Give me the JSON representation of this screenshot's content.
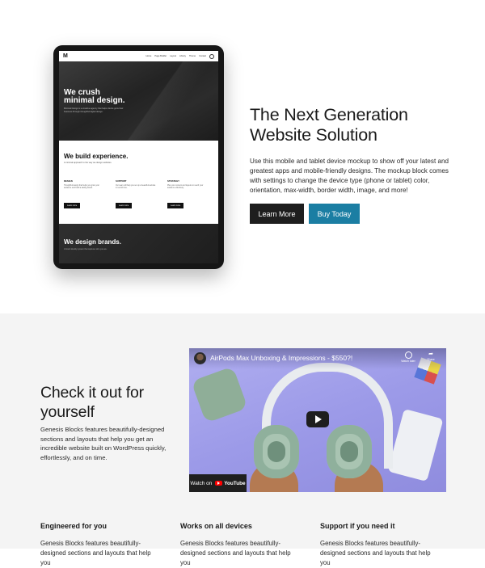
{
  "hero": {
    "title_line1": "The Next Generation",
    "title_line2": "Website Solution",
    "description": "Use this mobile and tablet device mockup to show off your latest and greatest apps and mobile-friendly designs. The mockup block comes with settings to change the device type (phone or tablet) color, orientation, max-width, border width, image, and more!",
    "buttons": {
      "learn_more": "Learn More",
      "buy_today": "Buy Today"
    }
  },
  "tablet": {
    "logo": "M",
    "nav": [
      "Home",
      "Page Builder",
      "Layout",
      "Library",
      "Theme",
      "Contact"
    ],
    "block1_title_line1": "We crush",
    "block1_title_line2": "minimal design.",
    "block1_text": "Minimal Design is a creative agency that helps clients grow their business through thoughtful digital design.",
    "block2_title": "We build experience.",
    "block2_text": "A minimal approach to the way we design websites.",
    "columns": [
      {
        "title": "DESIGN",
        "text": "Thoughtful design that helps you grow your audience and build a lasting brand.",
        "button": "Learn more"
      },
      {
        "title": "SUPPORT",
        "text": "Our team will help you set up a beautiful website in record time.",
        "button": "Learn more"
      },
      {
        "title": "STRATEGY",
        "text": "Plan your content and layouts to reach your audience effectively.",
        "button": "Learn more"
      }
    ],
    "block3_title": "We design brands.",
    "block3_text": "A brand identity system that captures who you are."
  },
  "video_section": {
    "title": "Check it out for yourself",
    "description": "Genesis Blocks features beautifully-designed sections and layouts that help you get an incredible website built on WordPress quickly, effortlessly, and on time.",
    "video": {
      "title": "AirPods Max Unboxing & Impressions - $550?!",
      "watch_later": "Watch later",
      "share": "Share",
      "watch_on": "Watch on",
      "youtube": "YouTube"
    }
  },
  "features": [
    {
      "title": "Engineered for you",
      "description": "Genesis Blocks features beautifully-designed sections and layouts that help you"
    },
    {
      "title": "Works on all devices",
      "description": "Genesis Blocks features beautifully-designed sections and layouts that help you"
    },
    {
      "title": "Support if you need it",
      "description": "Genesis Blocks features beautifully-designed sections and layouts that help you"
    }
  ],
  "colors": {
    "accent_blue": "#1b7ea3",
    "dark_button": "#1e1e1e",
    "section_bg": "#f4f4f4"
  }
}
